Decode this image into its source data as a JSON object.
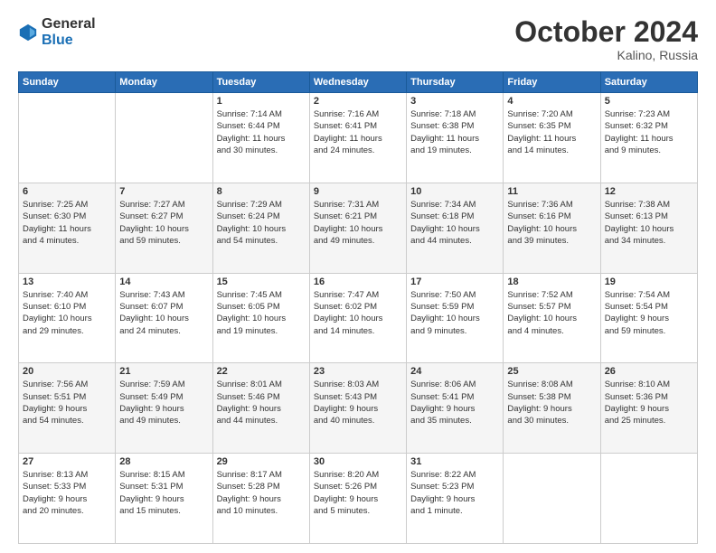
{
  "logo": {
    "general": "General",
    "blue": "Blue"
  },
  "title": "October 2024",
  "location": "Kalino, Russia",
  "days_of_week": [
    "Sunday",
    "Monday",
    "Tuesday",
    "Wednesday",
    "Thursday",
    "Friday",
    "Saturday"
  ],
  "weeks": [
    [
      {
        "day": "",
        "content": ""
      },
      {
        "day": "",
        "content": ""
      },
      {
        "day": "1",
        "content": "Sunrise: 7:14 AM\nSunset: 6:44 PM\nDaylight: 11 hours\nand 30 minutes."
      },
      {
        "day": "2",
        "content": "Sunrise: 7:16 AM\nSunset: 6:41 PM\nDaylight: 11 hours\nand 24 minutes."
      },
      {
        "day": "3",
        "content": "Sunrise: 7:18 AM\nSunset: 6:38 PM\nDaylight: 11 hours\nand 19 minutes."
      },
      {
        "day": "4",
        "content": "Sunrise: 7:20 AM\nSunset: 6:35 PM\nDaylight: 11 hours\nand 14 minutes."
      },
      {
        "day": "5",
        "content": "Sunrise: 7:23 AM\nSunset: 6:32 PM\nDaylight: 11 hours\nand 9 minutes."
      }
    ],
    [
      {
        "day": "6",
        "content": "Sunrise: 7:25 AM\nSunset: 6:30 PM\nDaylight: 11 hours\nand 4 minutes."
      },
      {
        "day": "7",
        "content": "Sunrise: 7:27 AM\nSunset: 6:27 PM\nDaylight: 10 hours\nand 59 minutes."
      },
      {
        "day": "8",
        "content": "Sunrise: 7:29 AM\nSunset: 6:24 PM\nDaylight: 10 hours\nand 54 minutes."
      },
      {
        "day": "9",
        "content": "Sunrise: 7:31 AM\nSunset: 6:21 PM\nDaylight: 10 hours\nand 49 minutes."
      },
      {
        "day": "10",
        "content": "Sunrise: 7:34 AM\nSunset: 6:18 PM\nDaylight: 10 hours\nand 44 minutes."
      },
      {
        "day": "11",
        "content": "Sunrise: 7:36 AM\nSunset: 6:16 PM\nDaylight: 10 hours\nand 39 minutes."
      },
      {
        "day": "12",
        "content": "Sunrise: 7:38 AM\nSunset: 6:13 PM\nDaylight: 10 hours\nand 34 minutes."
      }
    ],
    [
      {
        "day": "13",
        "content": "Sunrise: 7:40 AM\nSunset: 6:10 PM\nDaylight: 10 hours\nand 29 minutes."
      },
      {
        "day": "14",
        "content": "Sunrise: 7:43 AM\nSunset: 6:07 PM\nDaylight: 10 hours\nand 24 minutes."
      },
      {
        "day": "15",
        "content": "Sunrise: 7:45 AM\nSunset: 6:05 PM\nDaylight: 10 hours\nand 19 minutes."
      },
      {
        "day": "16",
        "content": "Sunrise: 7:47 AM\nSunset: 6:02 PM\nDaylight: 10 hours\nand 14 minutes."
      },
      {
        "day": "17",
        "content": "Sunrise: 7:50 AM\nSunset: 5:59 PM\nDaylight: 10 hours\nand 9 minutes."
      },
      {
        "day": "18",
        "content": "Sunrise: 7:52 AM\nSunset: 5:57 PM\nDaylight: 10 hours\nand 4 minutes."
      },
      {
        "day": "19",
        "content": "Sunrise: 7:54 AM\nSunset: 5:54 PM\nDaylight: 9 hours\nand 59 minutes."
      }
    ],
    [
      {
        "day": "20",
        "content": "Sunrise: 7:56 AM\nSunset: 5:51 PM\nDaylight: 9 hours\nand 54 minutes."
      },
      {
        "day": "21",
        "content": "Sunrise: 7:59 AM\nSunset: 5:49 PM\nDaylight: 9 hours\nand 49 minutes."
      },
      {
        "day": "22",
        "content": "Sunrise: 8:01 AM\nSunset: 5:46 PM\nDaylight: 9 hours\nand 44 minutes."
      },
      {
        "day": "23",
        "content": "Sunrise: 8:03 AM\nSunset: 5:43 PM\nDaylight: 9 hours\nand 40 minutes."
      },
      {
        "day": "24",
        "content": "Sunrise: 8:06 AM\nSunset: 5:41 PM\nDaylight: 9 hours\nand 35 minutes."
      },
      {
        "day": "25",
        "content": "Sunrise: 8:08 AM\nSunset: 5:38 PM\nDaylight: 9 hours\nand 30 minutes."
      },
      {
        "day": "26",
        "content": "Sunrise: 8:10 AM\nSunset: 5:36 PM\nDaylight: 9 hours\nand 25 minutes."
      }
    ],
    [
      {
        "day": "27",
        "content": "Sunrise: 8:13 AM\nSunset: 5:33 PM\nDaylight: 9 hours\nand 20 minutes."
      },
      {
        "day": "28",
        "content": "Sunrise: 8:15 AM\nSunset: 5:31 PM\nDaylight: 9 hours\nand 15 minutes."
      },
      {
        "day": "29",
        "content": "Sunrise: 8:17 AM\nSunset: 5:28 PM\nDaylight: 9 hours\nand 10 minutes."
      },
      {
        "day": "30",
        "content": "Sunrise: 8:20 AM\nSunset: 5:26 PM\nDaylight: 9 hours\nand 5 minutes."
      },
      {
        "day": "31",
        "content": "Sunrise: 8:22 AM\nSunset: 5:23 PM\nDaylight: 9 hours\nand 1 minute."
      },
      {
        "day": "",
        "content": ""
      },
      {
        "day": "",
        "content": ""
      }
    ]
  ]
}
